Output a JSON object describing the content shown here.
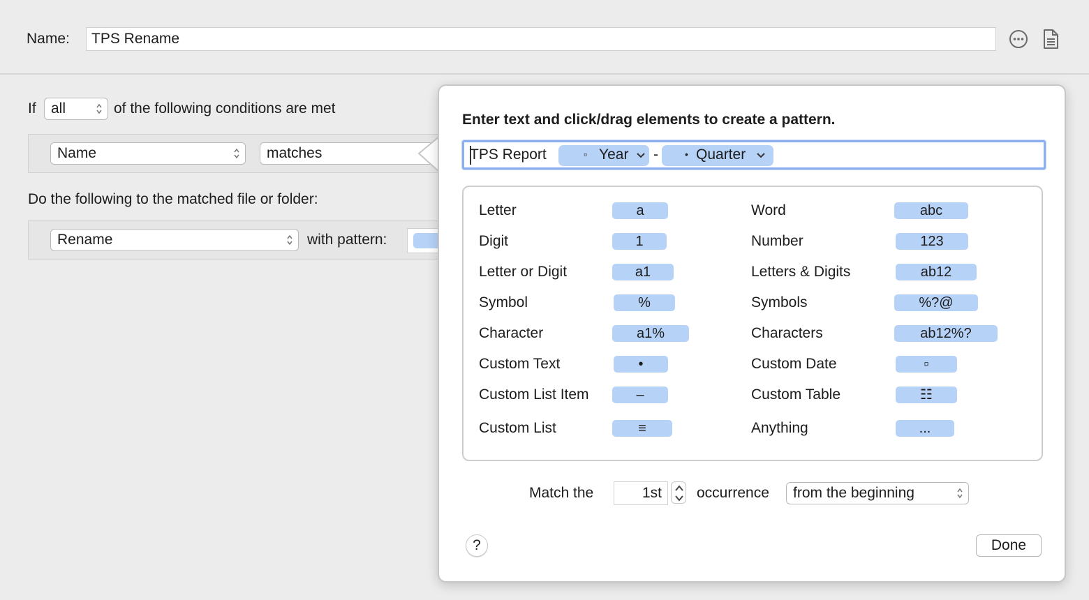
{
  "header": {
    "name_label": "Name:",
    "name_value": "TPS Rename"
  },
  "rule": {
    "if_label": "If",
    "all_value": "all",
    "conditions_suffix": "of the following conditions are met",
    "attribute_value": "Name",
    "operator_value": "matches",
    "actions_label": "Do the following to the matched file or folder:",
    "action_value": "Rename",
    "with_pattern_label": "with pattern:"
  },
  "popover": {
    "title": "Enter text and click/drag elements to create a pattern.",
    "pattern_text": "TPS Report",
    "token_year": "Year",
    "token_dash": "-",
    "token_quarter": "Quarter",
    "elements": [
      {
        "label": "Letter",
        "chip": "a"
      },
      {
        "label": "Word",
        "chip": "abc"
      },
      {
        "label": "Digit",
        "chip": "1"
      },
      {
        "label": "Number",
        "chip": "123"
      },
      {
        "label": "Letter or Digit",
        "chip": "a1"
      },
      {
        "label": "Letters & Digits",
        "chip": "ab12"
      },
      {
        "label": "Symbol",
        "chip": "%"
      },
      {
        "label": "Symbols",
        "chip": "%?@"
      },
      {
        "label": "Character",
        "chip": "a1%"
      },
      {
        "label": "Characters",
        "chip": "ab12%?"
      },
      {
        "label": "Custom Text",
        "chip": "•"
      },
      {
        "label": "Custom Date",
        "chip": "▫"
      },
      {
        "label": "Custom List Item",
        "chip": "–"
      },
      {
        "label": "Custom Table",
        "chip": "☷"
      },
      {
        "label": "Custom List",
        "chip": "≡"
      },
      {
        "label": "Anything",
        "chip": "..."
      }
    ],
    "match_the_label": "Match the",
    "occurrence_value": "1st",
    "occurrence_label": "occurrence",
    "direction_value": "from the beginning",
    "help_label": "?",
    "done_label": "Done"
  }
}
